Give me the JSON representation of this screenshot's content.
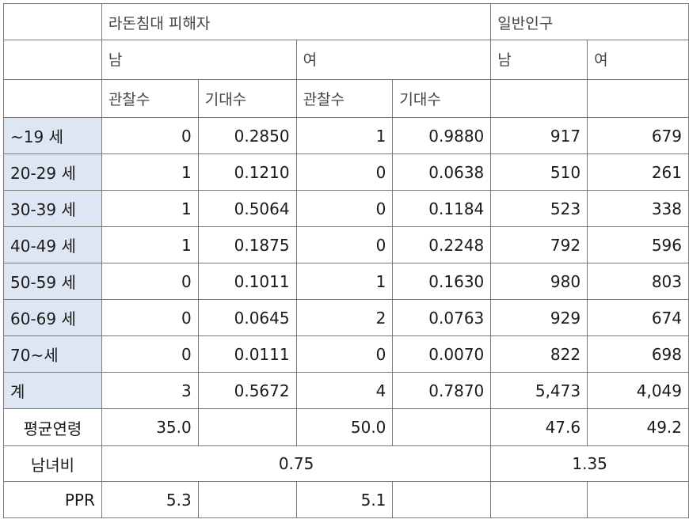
{
  "header": {
    "radon_victims": "라돈침대 피해자",
    "general_population": "일반인구",
    "male": "남",
    "female": "여",
    "observed": "관찰수",
    "expected": "기대수"
  },
  "rows": [
    {
      "label": "~19 세",
      "m_obs": "0",
      "m_exp": "0.2850",
      "f_obs": "1",
      "f_exp": "0.9880",
      "g_m": "917",
      "g_f": "679"
    },
    {
      "label": "20-29 세",
      "m_obs": "1",
      "m_exp": "0.1210",
      "f_obs": "0",
      "f_exp": "0.0638",
      "g_m": "510",
      "g_f": "261"
    },
    {
      "label": "30-39 세",
      "m_obs": "1",
      "m_exp": "0.5064",
      "f_obs": "0",
      "f_exp": "0.1184",
      "g_m": "523",
      "g_f": "338"
    },
    {
      "label": "40-49 세",
      "m_obs": "1",
      "m_exp": "0.1875",
      "f_obs": "0",
      "f_exp": "0.2248",
      "g_m": "792",
      "g_f": "596"
    },
    {
      "label": "50-59 세",
      "m_obs": "0",
      "m_exp": "0.1011",
      "f_obs": "1",
      "f_exp": "0.1630",
      "g_m": "980",
      "g_f": "803"
    },
    {
      "label": "60-69 세",
      "m_obs": "0",
      "m_exp": "0.0645",
      "f_obs": "2",
      "f_exp": "0.0763",
      "g_m": "929",
      "g_f": "674"
    },
    {
      "label": "70~세",
      "m_obs": "0",
      "m_exp": "0.0111",
      "f_obs": "0",
      "f_exp": "0.0070",
      "g_m": "822",
      "g_f": "698"
    },
    {
      "label": "계",
      "m_obs": "3",
      "m_exp": "0.5672",
      "f_obs": "4",
      "f_exp": "0.7870",
      "g_m": "5,473",
      "g_f": "4,049"
    }
  ],
  "mean_age": {
    "label": "평균연령",
    "m": "35.0",
    "f": "50.0",
    "g_m": "47.6",
    "g_f": "49.2"
  },
  "sex_ratio": {
    "label": "남녀비",
    "victims": "0.75",
    "general": "1.35"
  },
  "ppr": {
    "label": "PPR",
    "m": "5.3",
    "f": "5.1"
  }
}
